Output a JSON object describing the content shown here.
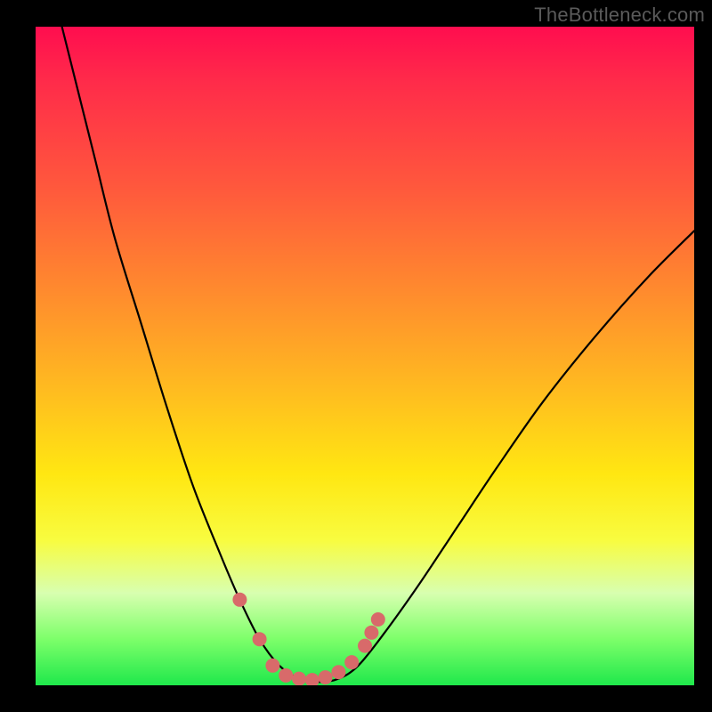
{
  "watermark": "TheBottleneck.com",
  "colors": {
    "background": "#000000",
    "curve": "#000000",
    "marker_fill": "#d86a6a",
    "marker_stroke": "#c05656",
    "gradient_stops": [
      "#ff0d4f",
      "#ff2a4a",
      "#ff5a3c",
      "#ff8a2e",
      "#ffbb20",
      "#ffe712",
      "#f8fc40",
      "#d8ffb0",
      "#7dff6a",
      "#1fe84b"
    ]
  },
  "chart_data": {
    "type": "line",
    "title": "",
    "subtitle": "",
    "xlabel": "",
    "ylabel": "",
    "xlim": [
      0,
      100
    ],
    "ylim": [
      0,
      100
    ],
    "grid": false,
    "legend": false,
    "curve_points": [
      {
        "x": 4,
        "y": 100
      },
      {
        "x": 6,
        "y": 92
      },
      {
        "x": 9,
        "y": 80
      },
      {
        "x": 12,
        "y": 68
      },
      {
        "x": 16,
        "y": 55
      },
      {
        "x": 20,
        "y": 42
      },
      {
        "x": 24,
        "y": 30
      },
      {
        "x": 28,
        "y": 20
      },
      {
        "x": 31,
        "y": 13
      },
      {
        "x": 34,
        "y": 7
      },
      {
        "x": 37,
        "y": 3
      },
      {
        "x": 40,
        "y": 1
      },
      {
        "x": 43,
        "y": 0.5
      },
      {
        "x": 46,
        "y": 1
      },
      {
        "x": 49,
        "y": 3
      },
      {
        "x": 53,
        "y": 8
      },
      {
        "x": 58,
        "y": 15
      },
      {
        "x": 64,
        "y": 24
      },
      {
        "x": 70,
        "y": 33
      },
      {
        "x": 77,
        "y": 43
      },
      {
        "x": 85,
        "y": 53
      },
      {
        "x": 93,
        "y": 62
      },
      {
        "x": 100,
        "y": 69
      }
    ],
    "markers": [
      {
        "x": 31,
        "y": 13
      },
      {
        "x": 34,
        "y": 7
      },
      {
        "x": 36,
        "y": 3
      },
      {
        "x": 38,
        "y": 1.5
      },
      {
        "x": 40,
        "y": 1
      },
      {
        "x": 42,
        "y": 0.8
      },
      {
        "x": 44,
        "y": 1.2
      },
      {
        "x": 46,
        "y": 2
      },
      {
        "x": 48,
        "y": 3.5
      },
      {
        "x": 50,
        "y": 6
      },
      {
        "x": 51,
        "y": 8
      },
      {
        "x": 52,
        "y": 10
      }
    ],
    "marker_radius": 8
  }
}
